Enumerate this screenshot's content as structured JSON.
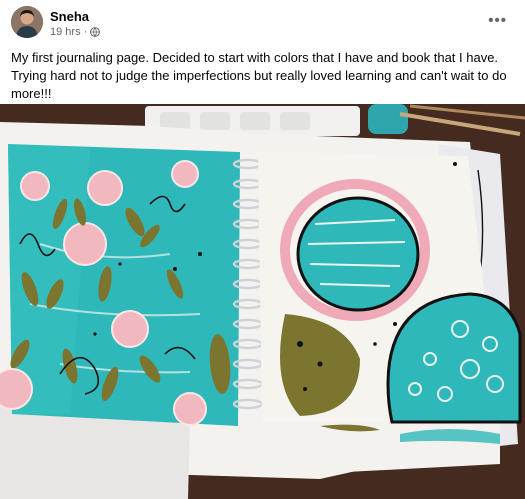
{
  "post": {
    "author": "Sneha",
    "time": "19 hrs",
    "separator": "·",
    "privacy_icon": "globe-icon",
    "more_icon": "more-options-icon",
    "more_glyph": "•••",
    "caption": "My first journaling page. Decided to start with colors that I have and book that I have. Trying hard not to judge the imperfections but really loved learning and can't wait to do more!!!"
  },
  "colors": {
    "teal": "#2fb8b9",
    "pink": "#f0a9b6",
    "olive": "#7b7530",
    "table": "#4a2e22"
  }
}
